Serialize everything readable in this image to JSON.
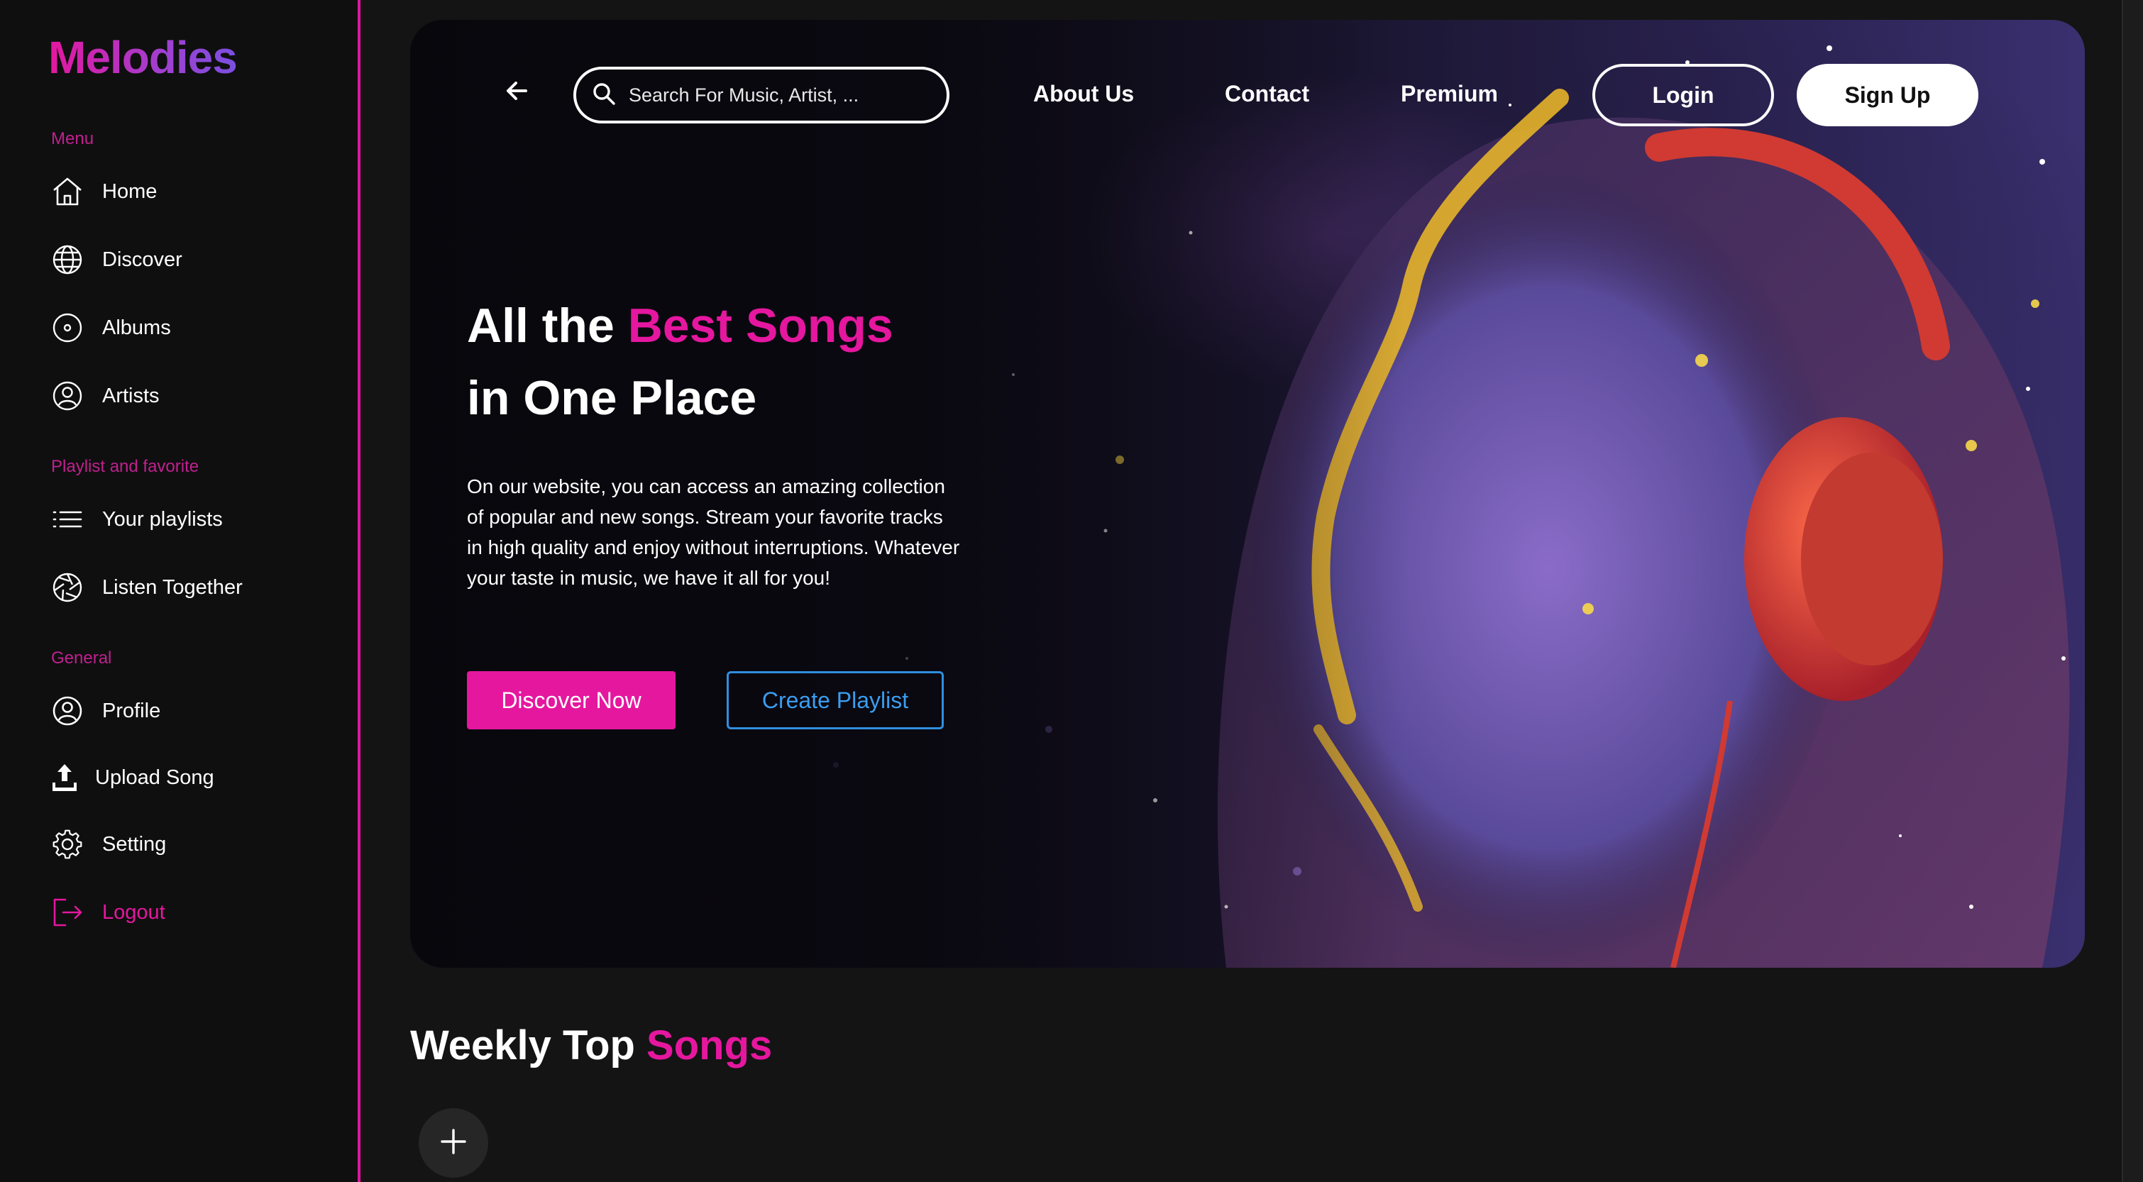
{
  "brand": {
    "name": "Melodies"
  },
  "sidebar": {
    "sections": [
      {
        "label": "Menu"
      },
      {
        "label": "Playlist and favorite"
      },
      {
        "label": "General"
      }
    ],
    "items": [
      {
        "label": "Home",
        "icon": "home-icon"
      },
      {
        "label": "Discover",
        "icon": "globe-icon"
      },
      {
        "label": "Albums",
        "icon": "disc-icon"
      },
      {
        "label": "Artists",
        "icon": "user-circle-icon"
      },
      {
        "label": "Your playlists",
        "icon": "list-icon"
      },
      {
        "label": "Listen Together",
        "icon": "aperture-icon"
      },
      {
        "label": "Profile",
        "icon": "profile-icon"
      },
      {
        "label": "Upload Song",
        "icon": "upload-icon"
      },
      {
        "label": "Setting",
        "icon": "gear-icon"
      },
      {
        "label": "Logout",
        "icon": "logout-icon"
      }
    ]
  },
  "topbar": {
    "search_placeholder": "Search For Music, Artist, ...",
    "links": [
      "About Us",
      "Contact",
      "Premium"
    ],
    "login_label": "Login",
    "signup_label": "Sign Up"
  },
  "hero": {
    "headline_part1": "All the ",
    "headline_accent": "Best Songs",
    "headline_part2": "in One Place",
    "description": "On our website, you can access an amazing collection of popular and new songs. Stream your favorite tracks in high quality and enjoy without interruptions. Whatever your taste in music, we have it all for you!",
    "primary_button": "Discover Now",
    "secondary_button": "Create Playlist"
  },
  "weekly": {
    "title_part1": "Weekly Top ",
    "title_accent": "Songs"
  },
  "colors": {
    "accent": "#e5179f",
    "secondary": "#2f8fe0",
    "background": "#141414",
    "sidebar": "#0f0f0f"
  }
}
